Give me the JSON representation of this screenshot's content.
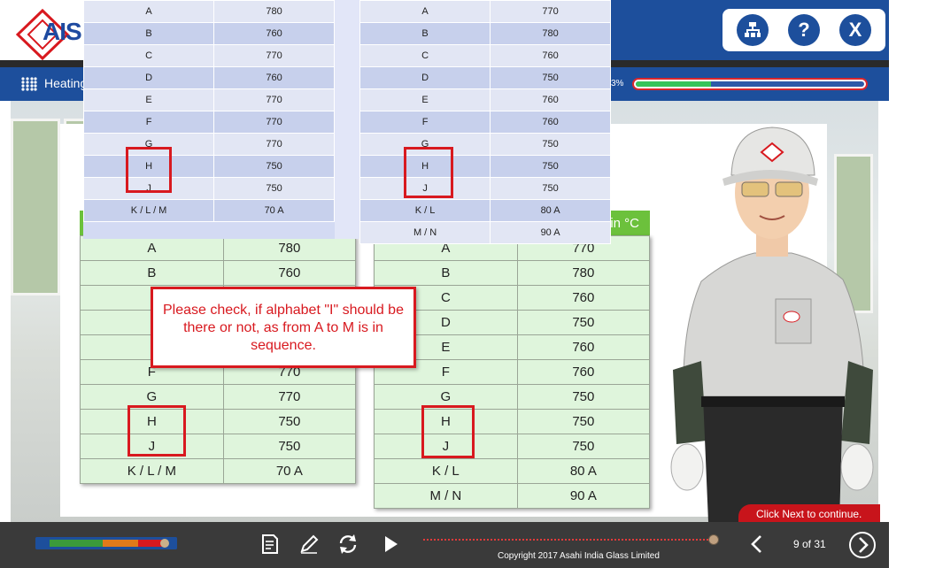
{
  "header": {
    "logo_text": "AIS",
    "buttons": [
      {
        "icon": "sitemap-icon"
      },
      {
        "label": "?"
      },
      {
        "label": "X"
      }
    ],
    "brand_color": "#1d4f9c"
  },
  "nav": {
    "title": "Heating",
    "progress_text": "3%",
    "progress_fill_fraction": 0.33
  },
  "overlay": {
    "left_rows": [
      [
        "A",
        "780"
      ],
      [
        "B",
        "760"
      ],
      [
        "C",
        "770"
      ],
      [
        "D",
        "760"
      ],
      [
        "E",
        "770"
      ],
      [
        "F",
        "770"
      ],
      [
        "G",
        "770"
      ],
      [
        "H",
        "750"
      ],
      [
        "J",
        "750"
      ],
      [
        "K / L / M",
        "70 A"
      ]
    ],
    "right_rows": [
      [
        "A",
        "770"
      ],
      [
        "B",
        "780"
      ],
      [
        "C",
        "760"
      ],
      [
        "D",
        "750"
      ],
      [
        "E",
        "760"
      ],
      [
        "F",
        "760"
      ],
      [
        "G",
        "750"
      ],
      [
        "H",
        "750"
      ],
      [
        "J",
        "750"
      ],
      [
        "K / L",
        "80 A"
      ],
      [
        "M / N",
        "90 A"
      ]
    ]
  },
  "main": {
    "right_header_fragment": "in °C",
    "left_rows": [
      [
        "A",
        "780"
      ],
      [
        "B",
        "760"
      ],
      [
        "",
        ""
      ],
      [
        "",
        ""
      ],
      [
        "",
        ""
      ],
      [
        "F",
        "770"
      ],
      [
        "G",
        "770"
      ],
      [
        "H",
        "750"
      ],
      [
        "J",
        "750"
      ],
      [
        "K / L / M",
        "70 A"
      ]
    ],
    "right_rows": [
      [
        "A",
        "770"
      ],
      [
        "B",
        "780"
      ],
      [
        "C",
        "760"
      ],
      [
        "D",
        "750"
      ],
      [
        "E",
        "760"
      ],
      [
        "F",
        "760"
      ],
      [
        "G",
        "750"
      ],
      [
        "H",
        "750"
      ],
      [
        "J",
        "750"
      ],
      [
        "K / L",
        "80 A"
      ],
      [
        "M / N",
        "90 A"
      ]
    ]
  },
  "callout": {
    "text": "Please check, if alphabet \"I\" should be there or not, as from A to M is in sequence."
  },
  "tip": {
    "text": "Click Next to continue."
  },
  "toolbar": {
    "copyright": "Copyright 2017 Asahi India Glass Limited",
    "page_indicator": "9 of 31",
    "seek_fraction": 0.98
  }
}
